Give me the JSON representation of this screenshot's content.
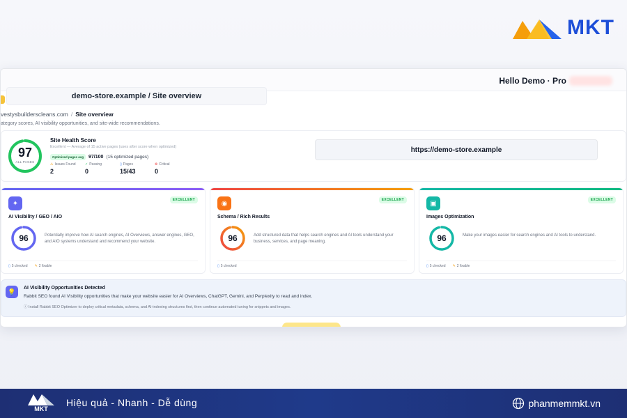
{
  "brand": {
    "name": "MKT",
    "color": "#1d4ed8"
  },
  "window": {
    "greeting": "Hello Demo · Pro",
    "title": "demo-store.example / Site overview",
    "breadcrumb": {
      "site": "vestysbuilderscleans.com",
      "separator": "/",
      "current": "Site overview"
    },
    "subtitle": "ategory scores, AI visibility opportunities, and site-wide recommendations."
  },
  "health": {
    "score": "97",
    "score_label": "ALL PAGES",
    "score_value": 97,
    "title": "Site Health Score",
    "description": "Excellent — Average of 15 active pages (uses after score when optimized)",
    "optimized_badge": "Optimized pages avg",
    "optimized_score": "97/100",
    "optimized_note": "(15 optimized pages)",
    "stats": [
      {
        "label": "Issues Found",
        "value": "2",
        "icon": "warning-icon"
      },
      {
        "label": "Passing",
        "value": "0",
        "icon": "check-circle-icon"
      },
      {
        "label": "Pages",
        "value": "15/43",
        "icon": "page-icon"
      },
      {
        "label": "Critical",
        "value": "0",
        "icon": "x-circle-icon"
      }
    ],
    "url": "https://demo-store.example"
  },
  "cards": [
    {
      "title": "AI Visibility / GEO / AIO",
      "badge": "EXCELLENT",
      "score": "96",
      "score_value": 96,
      "description": "Potentially improve how AI search engines, AI Overviews, answer engines, GEO, and AIO systems understand and recommend your website.",
      "checked": "5 checked",
      "fixable": "2 fixable",
      "accent": "#6366f1",
      "icon": "sparkle-icon"
    },
    {
      "title": "Schema / Rich Results",
      "badge": "EXCELLENT",
      "score": "96",
      "score_value": 96,
      "description": "Add structured data that helps search engines and AI tools understand your business, services, and page meaning.",
      "checked": "5 checked",
      "fixable": "",
      "accent": "#f97316",
      "icon": "schema-icon"
    },
    {
      "title": "Images Optimization",
      "badge": "EXCELLENT",
      "score": "96",
      "score_value": 96,
      "description": "Make your images easier for search engines and AI tools to understand.",
      "checked": "5 checked",
      "fixable": "2 fixable",
      "accent": "#14b8a6",
      "icon": "image-icon"
    }
  ],
  "opportunities": {
    "title": "AI Visibility Opportunities Detected",
    "description": "Rabbit SEO found AI Visibility opportunities that make your website easier for AI Overviews, ChatGPT, Gemini, and Perplexity to read and index.",
    "note": "Install Rabbit SEO Optimizer to deploy critical metadata, schema, and AI-indexing structures first, then continue automated tuning for snippets and images."
  },
  "footer": {
    "logo_text": "MKT",
    "slogan": "Hiệu quả - Nhanh - Dễ dùng",
    "website": "phanmemmkt.vn"
  }
}
